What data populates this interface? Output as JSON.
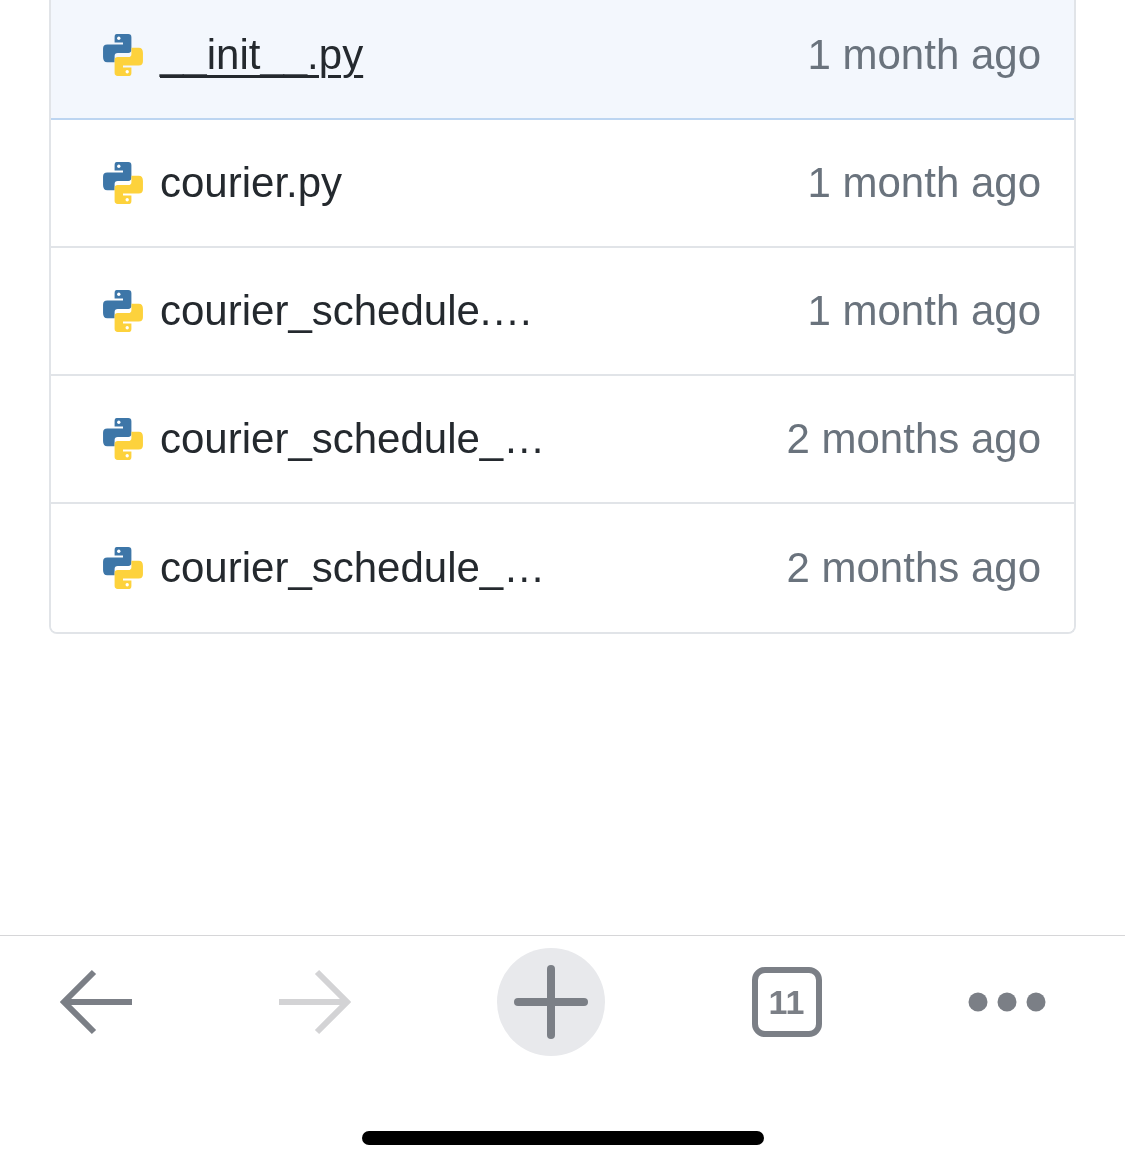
{
  "file_list": [
    {
      "name": "__init__.py",
      "modified": "1 month ago",
      "selected": true
    },
    {
      "name": "courier.py",
      "modified": "1 month ago",
      "selected": false
    },
    {
      "name": "courier_schedule.…",
      "modified": "1 month ago",
      "selected": false
    },
    {
      "name": "courier_schedule_…",
      "modified": "2 months ago",
      "selected": false
    },
    {
      "name": "courier_schedule_…",
      "modified": "2 months ago",
      "selected": false
    }
  ],
  "toolbar": [
    {
      "kind": "back",
      "disabled": false
    },
    {
      "kind": "forward",
      "disabled": true
    },
    {
      "kind": "new_tab",
      "disabled": false
    },
    {
      "kind": "tabs",
      "label": "11",
      "disabled": false
    },
    {
      "kind": "more",
      "disabled": false
    }
  ]
}
